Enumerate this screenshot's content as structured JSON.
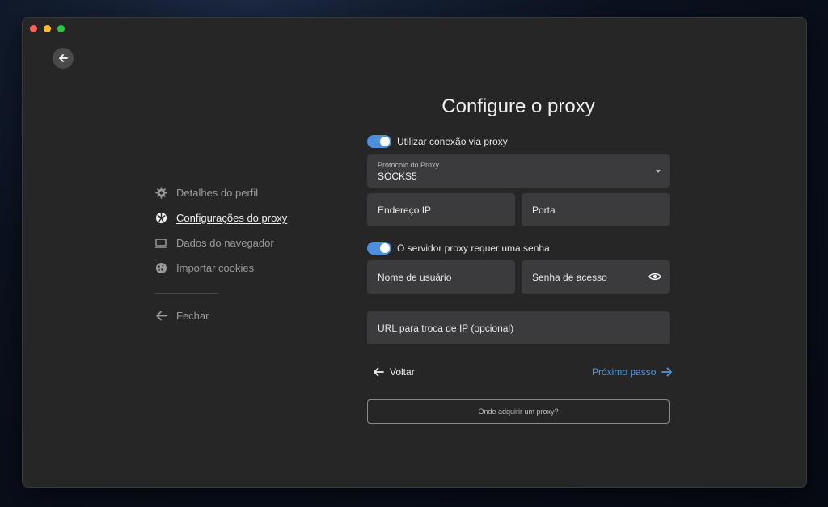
{
  "window": {
    "traffic_lights": [
      "close",
      "minimize",
      "zoom"
    ]
  },
  "header": {
    "back_icon": "arrow-left-icon"
  },
  "sidebar": {
    "items": [
      {
        "label": "Detalhes do perfil",
        "icon": "gear-icon",
        "active": false
      },
      {
        "label": "Configurações do proxy",
        "icon": "globe-icon",
        "active": true
      },
      {
        "label": "Dados do navegador",
        "icon": "laptop-icon",
        "active": false
      },
      {
        "label": "Importar cookies",
        "icon": "cookie-icon",
        "active": false
      }
    ],
    "close_label": "Fechar"
  },
  "main": {
    "title": "Configure o proxy",
    "use_proxy_toggle": {
      "label": "Utilizar conexão via proxy",
      "on": true
    },
    "protocol": {
      "label": "Protocolo do Proxy",
      "value": "SOCKS5"
    },
    "ip_placeholder": "Endereço IP",
    "port_placeholder": "Porta",
    "password_toggle": {
      "label": "O servidor proxy requer uma senha",
      "on": true
    },
    "username_placeholder": "Nome de usuário",
    "password_placeholder": "Senha de acesso",
    "url_placeholder": "URL para troca de IP (opcional)",
    "back_label": "Voltar",
    "next_label": "Próximo passo",
    "where_buy_label": "Onde adquirir um proxy?"
  },
  "colors": {
    "accent": "#4d9be6",
    "toggle_on": "#4d8fdc",
    "window_bg": "#262626",
    "field_bg": "#3b3b3d"
  }
}
